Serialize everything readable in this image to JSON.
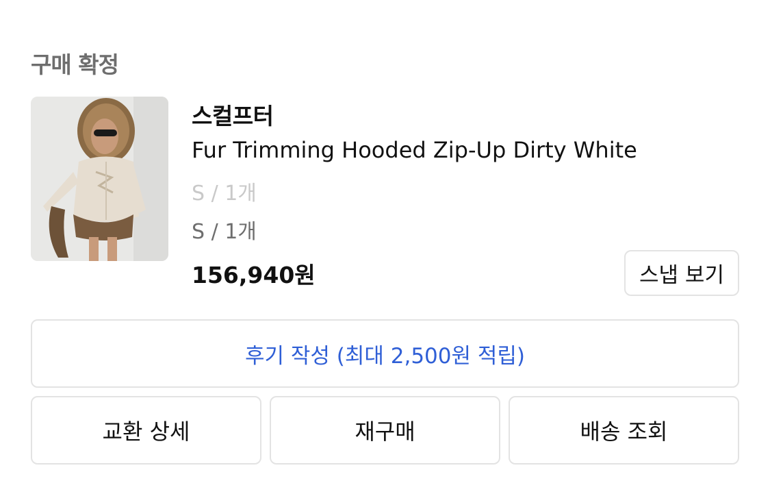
{
  "order": {
    "status": "구매 확정",
    "brand": "스컬프터",
    "product_name": "Fur Trimming Hooded Zip-Up Dirty White",
    "option_faded": "S / 1개",
    "option": "S / 1개",
    "price": "156,940원",
    "thumbnail_icon": "product-photo"
  },
  "buttons": {
    "snap": "스냅 보기",
    "review": "후기 작성 (최대 2,500원 적립)",
    "exchange_detail": "교환 상세",
    "repurchase": "재구매",
    "track_delivery": "배송 조회"
  },
  "colors": {
    "review_text": "#2f5fd6",
    "border": "#e3e3e3",
    "muted_text": "#6e6e6e"
  }
}
